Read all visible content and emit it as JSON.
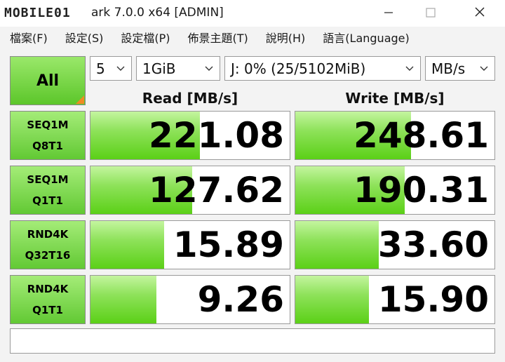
{
  "window": {
    "title": "ark 7.0.0 x64 [ADMIN]",
    "logo_text": "MOBILE01",
    "minimize": "—",
    "maximize": "☐",
    "close": "✕"
  },
  "menu": [
    "檔案(F)",
    "設定(S)",
    "設定檔(P)",
    "佈景主題(T)",
    "說明(H)",
    "語言(Language)"
  ],
  "controls": {
    "all_label": "All",
    "count": "5",
    "size": "1GiB",
    "drive": "J: 0% (25/5102MiB)",
    "unit": "MB/s"
  },
  "headers": {
    "read": "Read [MB/s]",
    "write": "Write [MB/s]"
  },
  "tests": [
    {
      "line1": "SEQ1M",
      "line2": "Q8T1",
      "read": "221.08",
      "write": "248.61",
      "read_fill": 0.55,
      "write_fill": 0.58
    },
    {
      "line1": "SEQ1M",
      "line2": "Q1T1",
      "read": "127.62",
      "write": "190.31",
      "read_fill": 0.51,
      "write_fill": 0.55
    },
    {
      "line1": "RND4K",
      "line2": "Q32T16",
      "read": "15.89",
      "write": "33.60",
      "read_fill": 0.37,
      "write_fill": 0.42
    },
    {
      "line1": "RND4K",
      "line2": "Q1T1",
      "read": "9.26",
      "write": "15.90",
      "read_fill": 0.33,
      "write_fill": 0.37
    }
  ],
  "status_text": ""
}
